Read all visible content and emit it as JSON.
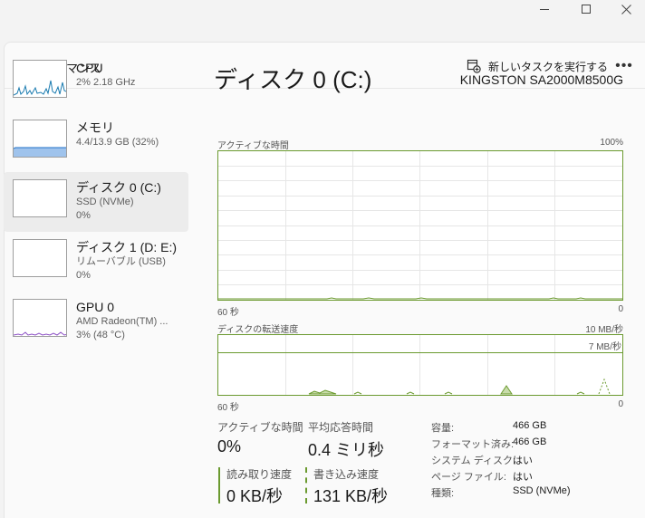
{
  "window": {
    "controls": [
      "minimize",
      "maximize",
      "close"
    ]
  },
  "header": {
    "title": "パフォーマンス",
    "run_task_label": "新しいタスクを実行する",
    "run_task_icon": "new-task-icon",
    "more_label": "•••"
  },
  "sidebar": {
    "items": [
      {
        "name": "CPU",
        "line1": "2%  2.18 GHz",
        "line2": "",
        "active": false
      },
      {
        "name": "メモリ",
        "line1": "4.4/13.9 GB (32%)",
        "line2": "",
        "active": false
      },
      {
        "name": "ディスク 0 (C:)",
        "line1": "SSD (NVMe)",
        "line2": "0%",
        "active": true
      },
      {
        "name": "ディスク 1 (D: E:)",
        "line1": "リムーバブル (USB)",
        "line2": "0%",
        "active": false
      },
      {
        "name": "GPU 0",
        "line1": "AMD Radeon(TM) ...",
        "line2": "3% (48 °C)",
        "active": false
      }
    ]
  },
  "main": {
    "title": "ディスク 0 (C:)",
    "model": "KINGSTON SA2000M8500G",
    "graph1": {
      "label": "アクティブな時間",
      "max": "100%",
      "time": "60 秒",
      "min": "0"
    },
    "graph2": {
      "label": "ディスクの転送速度",
      "max": "10 MB/秒",
      "line_label": "7 MB/秒",
      "time": "60 秒",
      "min": "0"
    },
    "stats": {
      "active_time_label": "アクティブな時間",
      "active_time_value": "0%",
      "response_label": "平均応答時間",
      "response_value": "0.4 ミリ秒",
      "read_label": "読み取り速度",
      "read_value": "0 KB/秒",
      "write_label": "書き込み速度",
      "write_value": "131 KB/秒"
    },
    "info": [
      {
        "key": "容量:",
        "value": "466 GB"
      },
      {
        "key": "フォーマット済み:",
        "value": "466 GB"
      },
      {
        "key": "システム ディスク:",
        "value": "はい"
      },
      {
        "key": "ページ ファイル:",
        "value": "はい"
      },
      {
        "key": "種類:",
        "value": "SSD (NVMe)"
      }
    ]
  },
  "colors": {
    "accent": "#6b9a2f",
    "grid": "#e3e3e3",
    "memory_fill": "#4a8ad4",
    "memory_line": "#1e6fc7",
    "gpu_line": "#8a4cc4",
    "cpu_line": "#1a7bb0"
  }
}
